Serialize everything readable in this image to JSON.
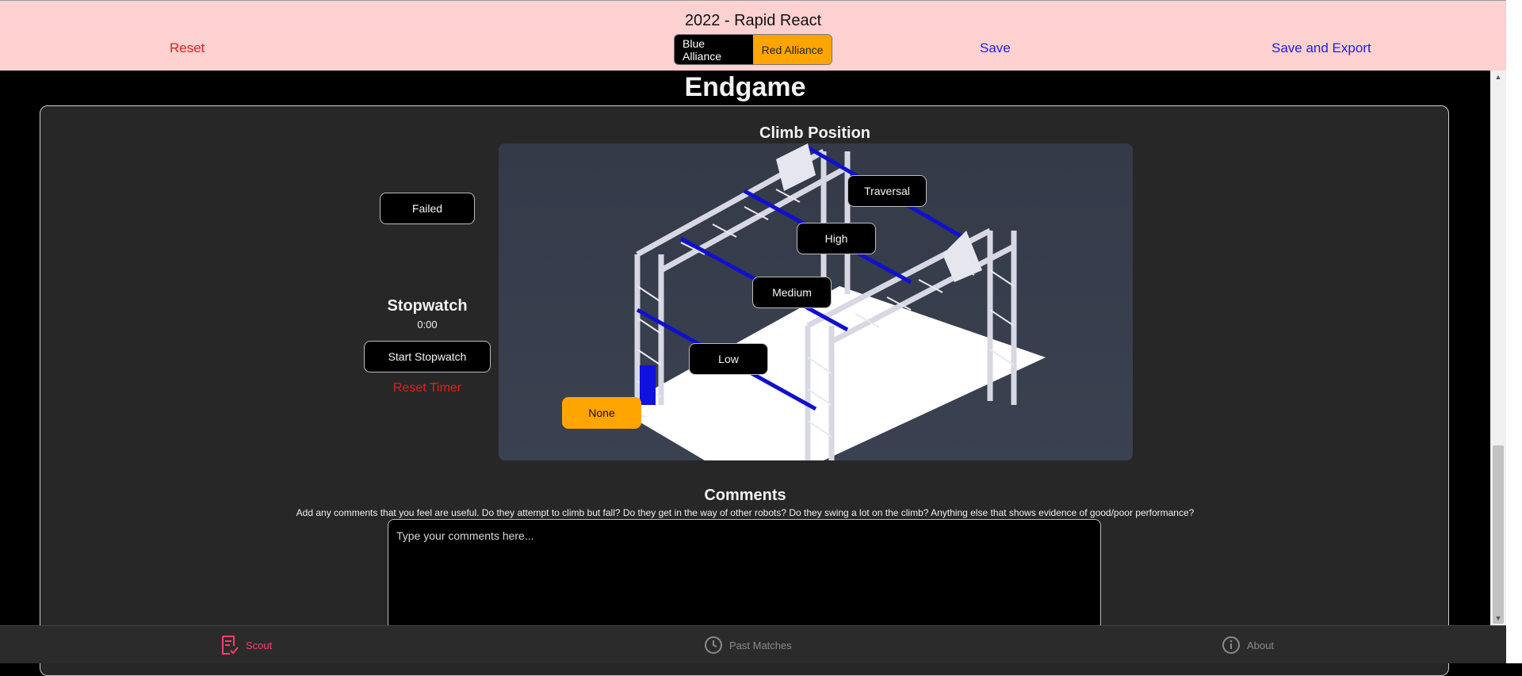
{
  "header": {
    "title": "2022 - Rapid React",
    "reset_label": "Reset",
    "save_label": "Save",
    "save_export_label": "Save and Export",
    "alliance": {
      "blue_label": "Blue Alliance",
      "red_label": "Red Alliance",
      "selected": "Blue Alliance"
    }
  },
  "main": {
    "section_title": "Endgame",
    "climb": {
      "title": "Climb Position",
      "failed_label": "Failed",
      "positions": {
        "traversal": "Traversal",
        "high": "High",
        "medium": "Medium",
        "low": "Low",
        "none": "None"
      },
      "selected": "None"
    },
    "stopwatch": {
      "title": "Stopwatch",
      "time": "0:00",
      "start_label": "Start Stopwatch",
      "reset_label": "Reset Timer"
    },
    "comments": {
      "title": "Comments",
      "hint": "Add any comments that you feel are useful. Do they attempt to climb but fall? Do they get in the way of other robots? Do they swing a lot on the climb? Anything else that shows evidence of good/poor performance?",
      "placeholder": "Type your comments here..."
    }
  },
  "bottom_nav": {
    "items": [
      {
        "label": "Scout",
        "icon": "scout-icon",
        "active": true
      },
      {
        "label": "Past Matches",
        "icon": "clock-icon",
        "active": false
      },
      {
        "label": "About",
        "icon": "info-icon",
        "active": false
      }
    ]
  },
  "colors": {
    "header_bg": "#ffd1d1",
    "accent_orange": "#ffa500",
    "danger": "#e02020",
    "link_blue": "#2020e0",
    "active_nav": "#ff3d6e"
  }
}
